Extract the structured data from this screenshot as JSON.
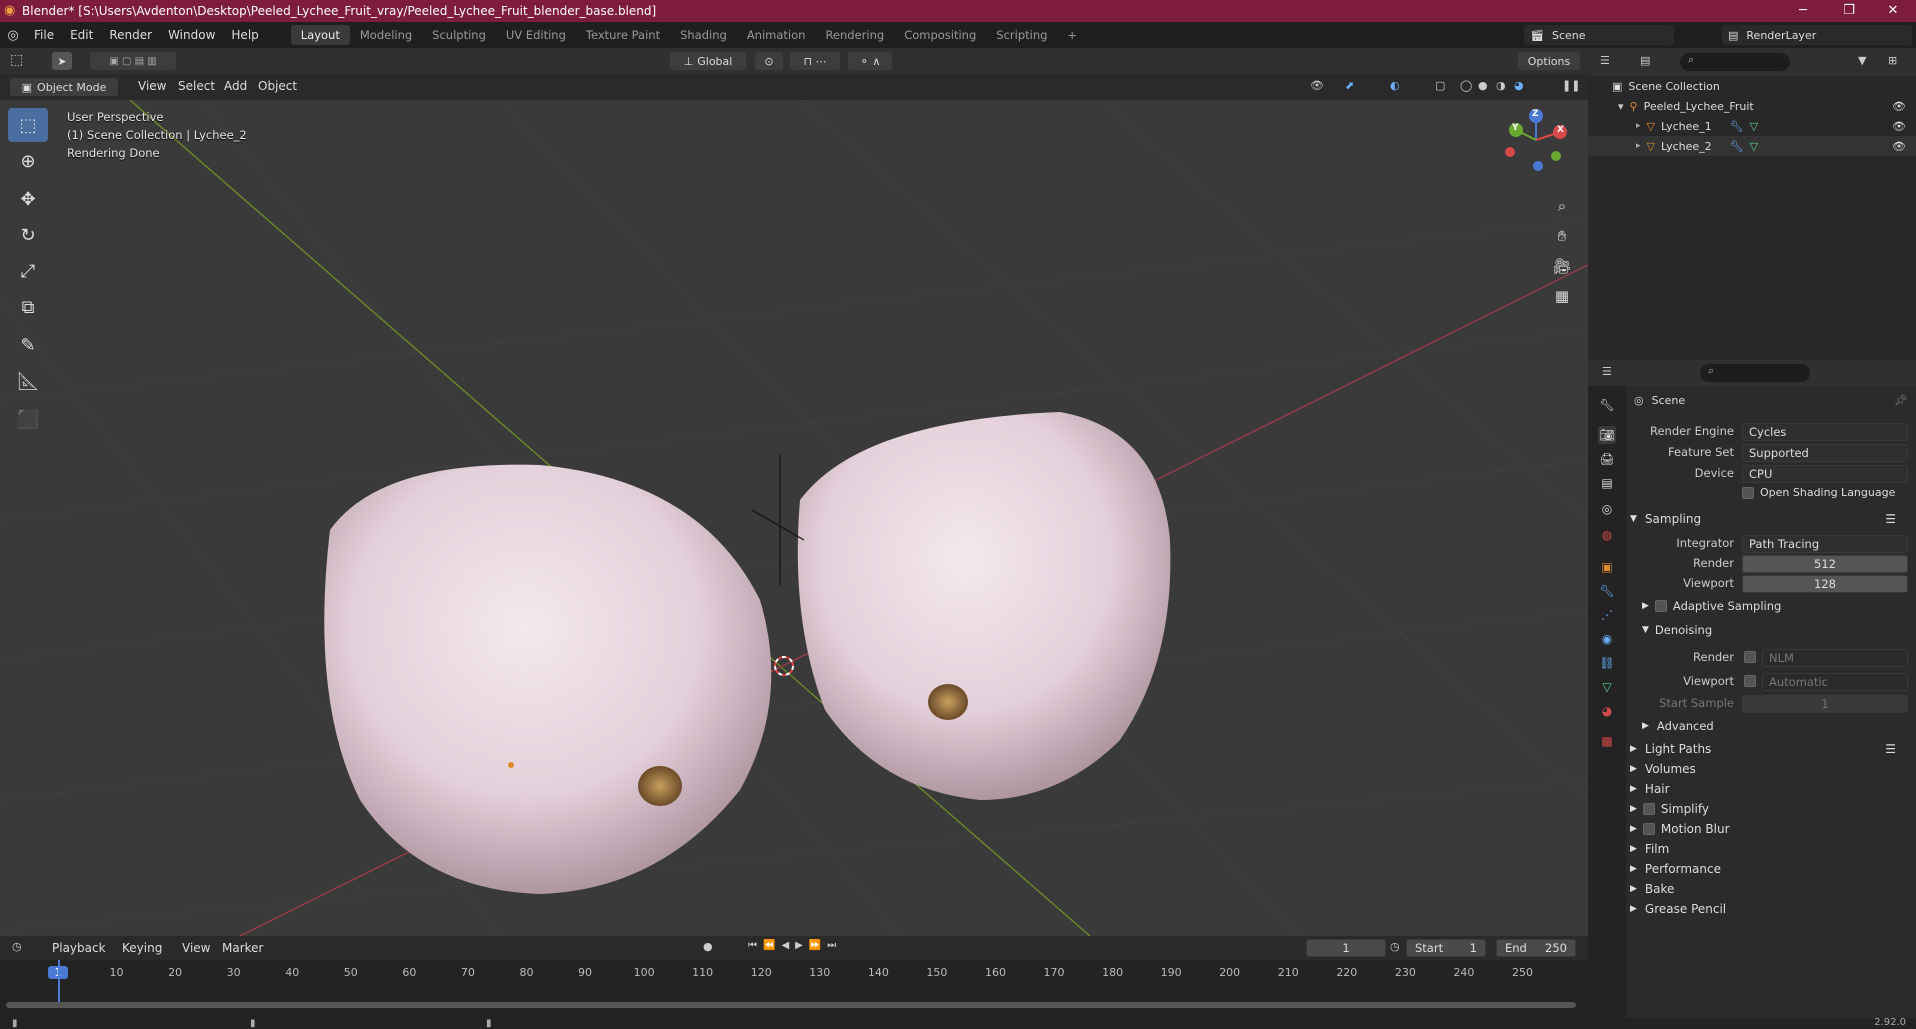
{
  "window": {
    "title": "Blender* [S:\\Users\\Avdenton\\Desktop\\Peeled_Lychee_Fruit_vray/Peeled_Lychee_Fruit_blender_base.blend]",
    "minimize": "─",
    "maximize": "❐",
    "close": "✕"
  },
  "menu": [
    "File",
    "Edit",
    "Render",
    "Window",
    "Help"
  ],
  "workspaces": [
    "Layout",
    "Modeling",
    "Sculpting",
    "UV Editing",
    "Texture Paint",
    "Shading",
    "Animation",
    "Rendering",
    "Compositing",
    "Scripting",
    "+"
  ],
  "top_right": {
    "scene_label": "Scene",
    "render_layer": "RenderLayer"
  },
  "viewport_header": {
    "orientation": "Global",
    "options": "Options",
    "mode": "Object Mode",
    "menus": [
      "View",
      "Select",
      "Add",
      "Object"
    ]
  },
  "viewport": {
    "info_line1": "User Perspective",
    "info_line2": "(1) Scene Collection | Lychee_2",
    "info_line3": "Rendering Done",
    "gizmo_x": "X",
    "gizmo_y": "Y",
    "gizmo_z": "Z"
  },
  "outliner": {
    "root": "Scene Collection",
    "collection": "Peeled_Lychee_Fruit",
    "items": [
      "Lychee_1",
      "Lychee_2"
    ]
  },
  "properties": {
    "scene_name": "Scene",
    "render_engine_label": "Render Engine",
    "render_engine": "Cycles",
    "feature_set_label": "Feature Set",
    "feature_set": "Supported",
    "device_label": "Device",
    "device": "CPU",
    "osl": "Open Shading Language",
    "sampling": "Sampling",
    "integrator_label": "Integrator",
    "integrator": "Path Tracing",
    "render_label": "Render",
    "render_samples": "512",
    "viewport_label": "Viewport",
    "viewport_samples": "128",
    "adaptive": "Adaptive Sampling",
    "denoising": "Denoising",
    "den_render_label": "Render",
    "den_render": "NLM",
    "den_viewport_label": "Viewport",
    "den_viewport": "Automatic",
    "start_sample_label": "Start Sample",
    "start_sample": "1",
    "advanced": "Advanced",
    "panels": [
      "Light Paths",
      "Volumes",
      "Hair",
      "Simplify",
      "Motion Blur",
      "Film",
      "Performance",
      "Bake",
      "Grease Pencil"
    ]
  },
  "timeline": {
    "menus": [
      "Playback",
      "Keying",
      "View",
      "Marker"
    ],
    "current_frame": "1",
    "start_label": "Start",
    "start": "1",
    "end_label": "End",
    "end": "250",
    "ticks": [
      "1",
      "10",
      "20",
      "30",
      "40",
      "50",
      "60",
      "70",
      "80",
      "90",
      "100",
      "110",
      "120",
      "130",
      "140",
      "150",
      "160",
      "170",
      "180",
      "190",
      "200",
      "210",
      "220",
      "230",
      "240",
      "250"
    ]
  },
  "status": {
    "version": "2.92.0"
  }
}
